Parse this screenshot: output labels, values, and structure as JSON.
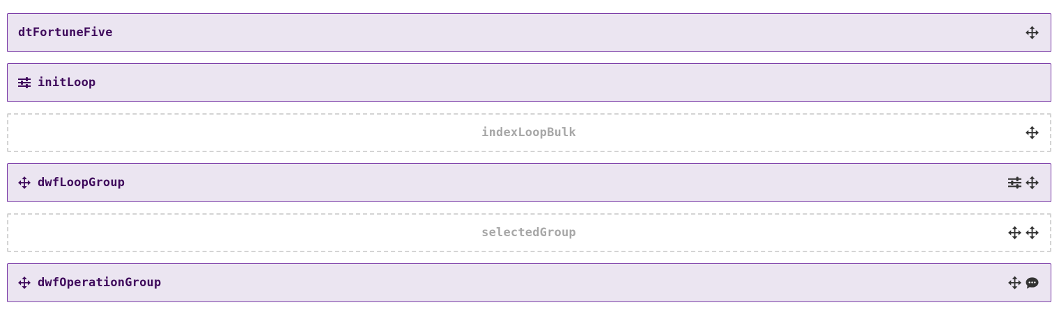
{
  "rows": [
    {
      "label": "dtFortuneFive",
      "style": "filled",
      "leading_icon": null,
      "actions": [
        "move-icon"
      ]
    },
    {
      "label": "initLoop",
      "style": "filled",
      "leading_icon": "sliders-icon",
      "actions": []
    },
    {
      "label": "indexLoopBulk",
      "style": "empty",
      "leading_icon": null,
      "actions": [
        "move-icon"
      ]
    },
    {
      "label": "dwfLoopGroup",
      "style": "filled",
      "leading_icon": "move-icon",
      "actions": [
        "sliders-icon",
        "move-icon"
      ]
    },
    {
      "label": "selectedGroup",
      "style": "empty",
      "leading_icon": null,
      "actions": [
        "move-icon",
        "move-icon"
      ]
    },
    {
      "label": "dwfOperationGroup",
      "style": "filled",
      "leading_icon": "move-icon",
      "actions": [
        "move-icon",
        "comment-icon"
      ]
    }
  ],
  "colors": {
    "filled_bg": "#ebe5f1",
    "filled_border": "#7a3aa7",
    "label_text": "#3f0a5c",
    "placeholder_text": "#a7a7a7",
    "dashed_border": "#d4d4d4",
    "icon_dark": "#333333"
  }
}
